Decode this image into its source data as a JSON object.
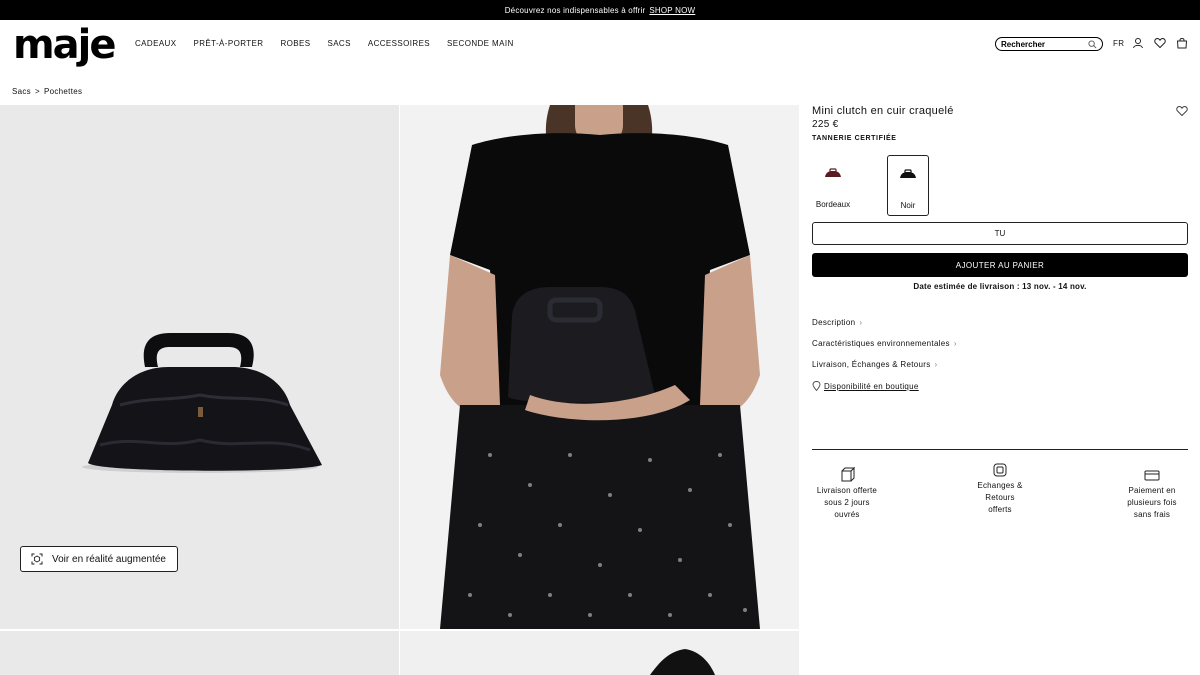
{
  "promo": {
    "text": "Découvrez nos indispensables à offrir",
    "link": "SHOP NOW"
  },
  "header": {
    "logo": "maje",
    "nav": [
      "CADEAUX",
      "PRÊT-À-PORTER",
      "ROBES",
      "SACS",
      "ACCESSOIRES",
      "SECONDE MAIN"
    ],
    "search_placeholder": "Rechercher",
    "lang": "FR",
    "icons": [
      "search-icon",
      "user-icon",
      "heart-icon",
      "bag-icon"
    ]
  },
  "breadcrumb": {
    "items": [
      "Sacs",
      "Pochettes"
    ],
    "separator": ">"
  },
  "gallery": {
    "ar_button": "Voir en réalité augmentée"
  },
  "product": {
    "title": "Mini clutch en cuir craquelé",
    "price": "225 €",
    "badge": "TANNERIE CERTIFIÉE",
    "colors": [
      {
        "label": "Bordeaux",
        "hex": "#5a1a22",
        "selected": false
      },
      {
        "label": "Noir",
        "hex": "#111111",
        "selected": true
      }
    ],
    "size": "TU",
    "add_to_cart": "AJOUTER AU PANIER",
    "delivery": "Date estimée de livraison : 13 nov. - 14 nov.",
    "accordions": [
      "Description",
      "Caractéristiques environnementales",
      "Livraison, Échanges & Retours"
    ],
    "store_link": "Disponibilité en boutique"
  },
  "advantages": [
    {
      "icon": "delivery-box-icon",
      "lines": [
        "Livraison offerte",
        "sous 2 jours",
        "ouvrés"
      ]
    },
    {
      "icon": "exchange-icon",
      "lines": [
        "Echanges &",
        "Retours",
        "offerts"
      ]
    },
    {
      "icon": "credit-card-icon",
      "lines": [
        "Paiement en",
        "plusieurs fois",
        "sans frais"
      ]
    }
  ]
}
